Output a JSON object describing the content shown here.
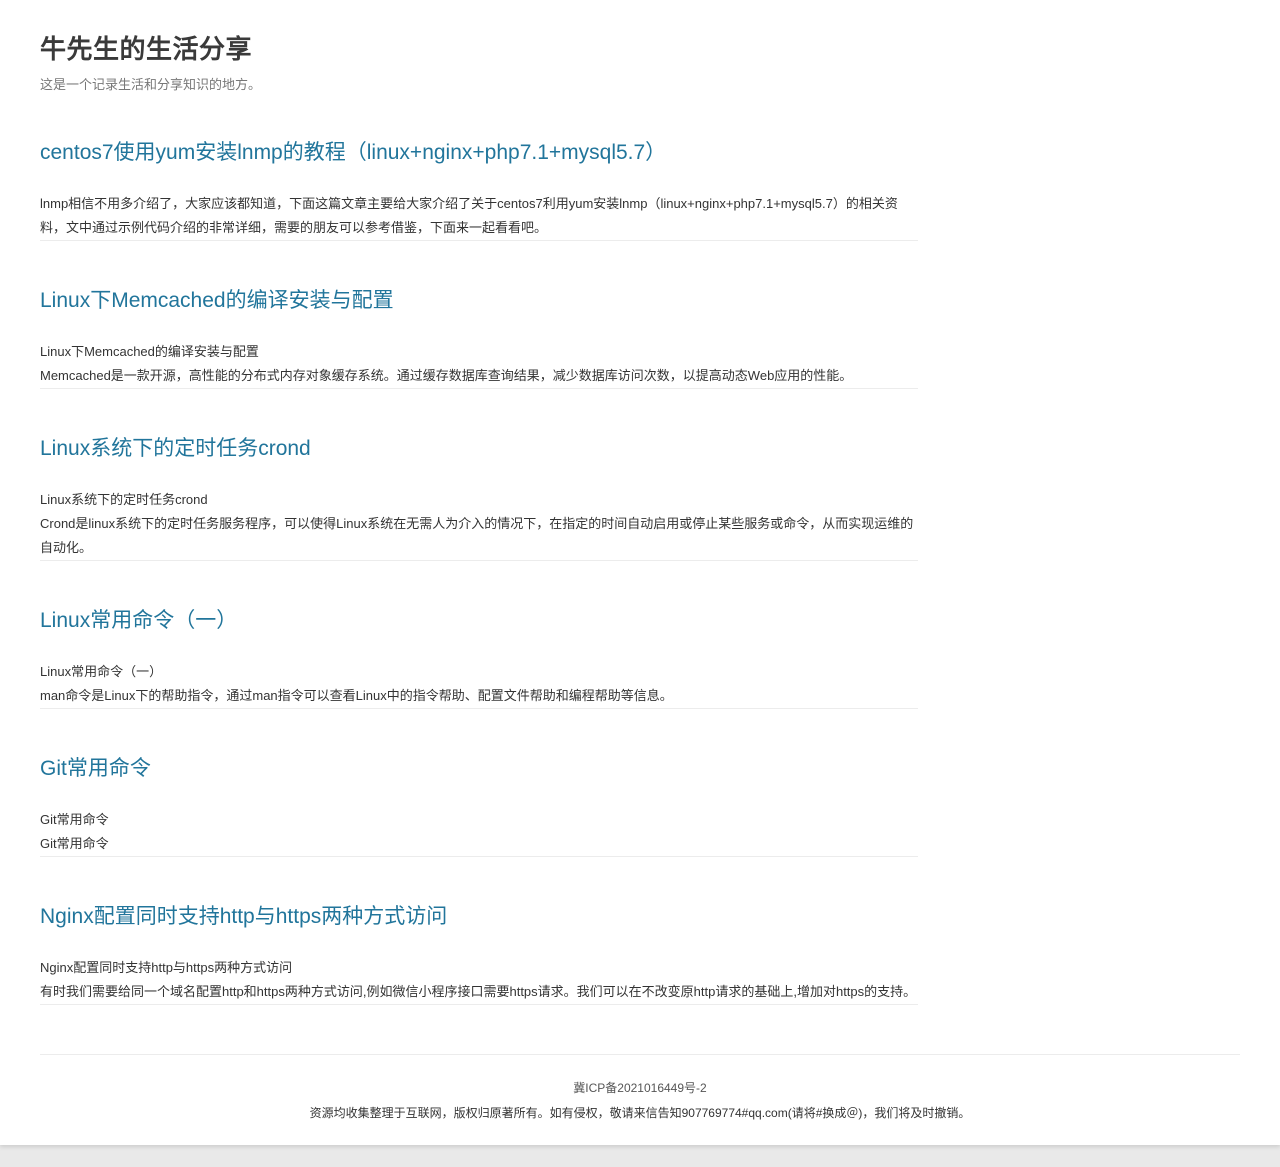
{
  "site": {
    "title": "牛先生的生活分享",
    "description": "这是一个记录生活和分享知识的地方。"
  },
  "posts": [
    {
      "title": "centos7使用yum安装lnmp的教程（linux+nginx+php7.1+mysql5.7）",
      "lines": [
        "lnmp相信不用多介绍了，大家应该都知道，下面这篇文章主要给大家介绍了关于centos7利用yum安装lnmp（linux+nginx+php7.1+mysql5.7）的相关资料，文中通过示例代码介绍的非常详细，需要的朋友可以参考借鉴，下面来一起看看吧。"
      ]
    },
    {
      "title": "Linux下Memcached的编译安装与配置",
      "lines": [
        "Linux下Memcached的编译安装与配置",
        "Memcached是一款开源，高性能的分布式内存对象缓存系统。通过缓存数据库查询结果，减少数据库访问次数，以提高动态Web应用的性能。"
      ]
    },
    {
      "title": "Linux系统下的定时任务crond",
      "lines": [
        "Linux系统下的定时任务crond",
        "Crond是linux系统下的定时任务服务程序，可以使得Linux系统在无需人为介入的情况下，在指定的时间自动启用或停止某些服务或命令，从而实现运维的自动化。"
      ]
    },
    {
      "title": "Linux常用命令（一）",
      "lines": [
        "Linux常用命令（一）",
        "man命令是Linux下的帮助指令，通过man指令可以查看Linux中的指令帮助、配置文件帮助和编程帮助等信息。"
      ]
    },
    {
      "title": "Git常用命令",
      "lines": [
        "Git常用命令",
        "Git常用命令"
      ]
    },
    {
      "title": "Nginx配置同时支持http与https两种方式访问",
      "lines": [
        "Nginx配置同时支持http与https两种方式访问",
        "有时我们需要给同一个域名配置http和https两种方式访问,例如微信小程序接口需要https请求。我们可以在不改变原http请求的基础上,增加对https的支持。"
      ]
    }
  ],
  "footer": {
    "icp": "冀ICP备2021016449号-2",
    "notice": "资源均收集整理于互联网，版权归原著所有。如有侵权，敬请来信告知907769774#qq.com(请将#换成＠)，我们将及时撤销。"
  },
  "colors": {
    "link": "#21759b",
    "title": "#3a3a3a",
    "background": "#e9e9e9"
  }
}
